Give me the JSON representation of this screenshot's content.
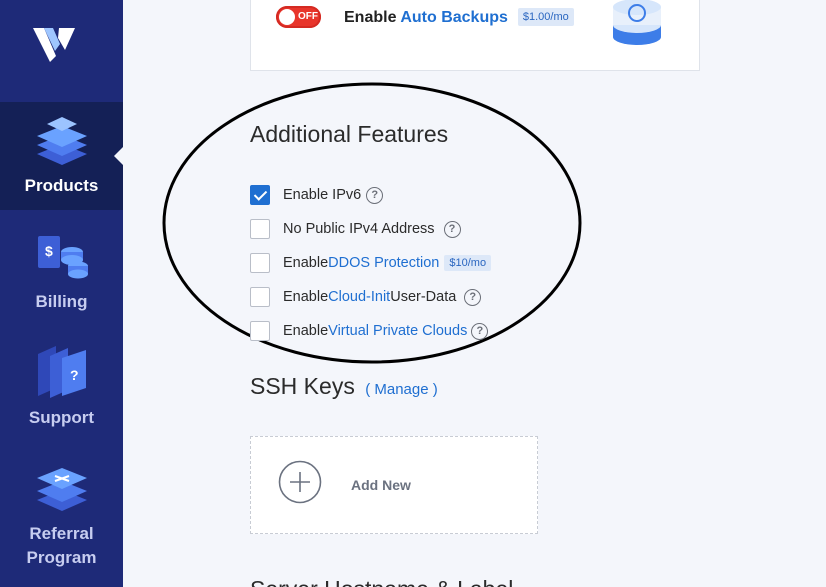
{
  "sidebar": {
    "items": [
      {
        "label": "Products",
        "icon": "products-icon",
        "active": true
      },
      {
        "label": "Billing",
        "icon": "billing-icon"
      },
      {
        "label": "Support",
        "icon": "support-icon"
      },
      {
        "label_line1": "Referral",
        "label_line2": "Program",
        "icon": "referral-icon"
      }
    ]
  },
  "backups": {
    "toggle_label": "OFF",
    "label_prefix": "Enable ",
    "label_link": "Auto Backups",
    "price": "$1.00/mo"
  },
  "features": {
    "title": "Additional Features",
    "items": [
      {
        "checked": true,
        "prefix": "Enable IPv6",
        "link": "",
        "suffix": "",
        "help": true
      },
      {
        "checked": false,
        "prefix": "No Public IPv4 Address",
        "link": "",
        "suffix": "",
        "help": true
      },
      {
        "checked": false,
        "prefix": "Enable ",
        "link": "DDOS Protection",
        "suffix": "",
        "badge": "$10/mo"
      },
      {
        "checked": false,
        "prefix": "Enable ",
        "link": "Cloud-Init",
        "suffix": " User-Data",
        "help": true
      },
      {
        "checked": false,
        "prefix": "Enable ",
        "link": "Virtual Private Clouds",
        "suffix": "",
        "help": true
      }
    ],
    "help_glyph": "?"
  },
  "ssh": {
    "title": "SSH Keys",
    "manage_label": "( Manage )",
    "add_new_label": "Add New"
  },
  "next_section_title": "Server Hostname & Label",
  "colors": {
    "sidebar": "#1e2a78",
    "sidebar_active": "#142056",
    "accent": "#1f6fd1",
    "toggle_off": "#e8352b"
  }
}
